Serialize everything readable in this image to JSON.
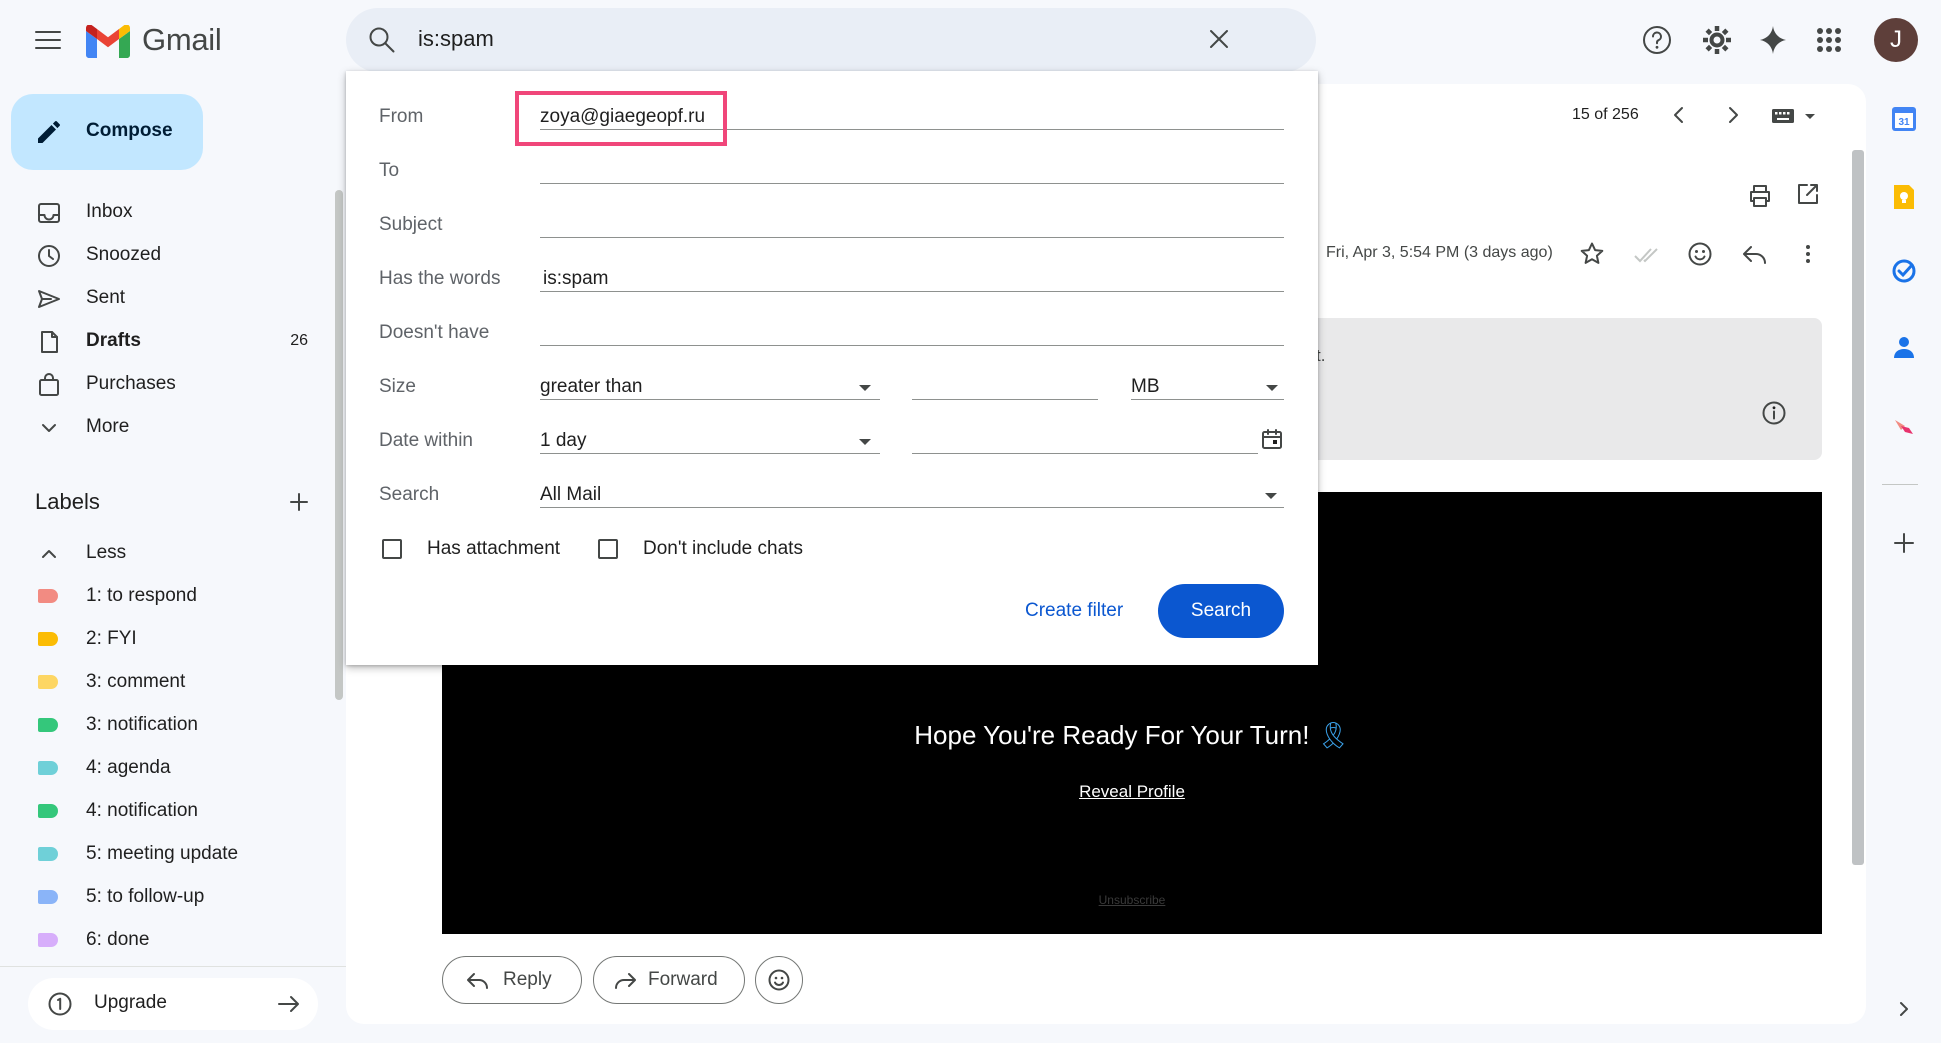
{
  "header": {
    "app_name": "Gmail",
    "search_query": "is:spam"
  },
  "user": {
    "avatar_initial": "J"
  },
  "sidebar": {
    "compose_label": "Compose",
    "items": [
      {
        "label": "Inbox",
        "icon": "inbox-icon"
      },
      {
        "label": "Snoozed",
        "icon": "clock-icon"
      },
      {
        "label": "Sent",
        "icon": "send-icon"
      },
      {
        "label": "Drafts",
        "icon": "draft-icon",
        "count": "26"
      },
      {
        "label": "Purchases",
        "icon": "shopping-bag-icon"
      },
      {
        "label": "More",
        "icon": "chevron-down-icon"
      }
    ],
    "labels_title": "Labels",
    "labels_toggle": "Less",
    "labels": [
      {
        "name": "1: to respond",
        "color": "#f28b82"
      },
      {
        "name": "2: FYI",
        "color": "#fbbc04"
      },
      {
        "name": "3: comment",
        "color": "#fdd663"
      },
      {
        "name": "3: notification",
        "color": "#34c77b"
      },
      {
        "name": "4: agenda",
        "color": "#6fd0d8"
      },
      {
        "name": "4: notification",
        "color": "#34c77b"
      },
      {
        "name": "5: meeting update",
        "color": "#6fd0d8"
      },
      {
        "name": "5: to follow-up",
        "color": "#8ab4f8"
      },
      {
        "name": "6: done",
        "color": "#d7aefb"
      }
    ],
    "upgrade_label": "Upgrade"
  },
  "message": {
    "pager": "15 of 256",
    "date": "Fri, Apr 3, 5:54 PM (3 days ago)",
    "notice_fragment": "t.",
    "headline": "Hope You're Ready For Your Turn!",
    "headline_emoji": "🎗",
    "reveal_link": "Reveal Profile",
    "unsubscribe_link": "Unsubscribe",
    "reply_label": "Reply",
    "forward_label": "Forward"
  },
  "search_options": {
    "from_label": "From",
    "from_value": "zoya@giaegeopf.ru",
    "to_label": "To",
    "to_value": "",
    "subject_label": "Subject",
    "subject_value": "",
    "has_words_label": "Has the words",
    "has_words_value": "is:spam",
    "doesnt_have_label": "Doesn't have",
    "doesnt_have_value": "",
    "size_label": "Size",
    "size_operator": "greater than",
    "size_value": "",
    "size_unit": "MB",
    "date_within_label": "Date within",
    "date_within_value": "1 day",
    "date_value": "",
    "search_in_label": "Search",
    "search_in_value": "All Mail",
    "has_attachment_label": "Has attachment",
    "has_attachment_checked": false,
    "dont_include_chats_label": "Don't include chats",
    "dont_include_chats_checked": false,
    "create_filter_label": "Create filter",
    "search_button_label": "Search"
  },
  "colors": {
    "accent": "#0b57d0",
    "compose_bg": "#c2e7ff",
    "highlight": "#f0467a"
  }
}
